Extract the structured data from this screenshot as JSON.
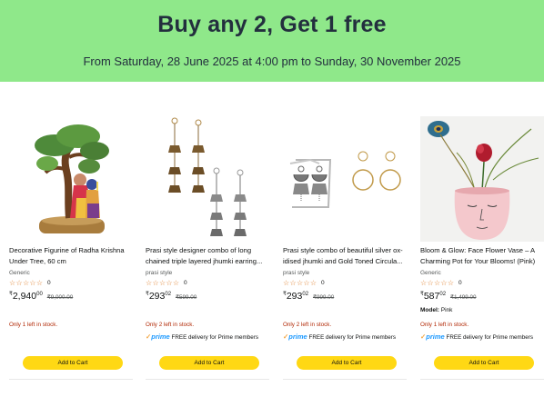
{
  "banner": {
    "title": "Buy any 2, Get 1 free",
    "subtitle": "From Saturday, 28 June 2025 at 4:00 pm to Sunday, 30 November 2025"
  },
  "colors": {
    "banner_bg": "#8fe88a",
    "button": "#ffd814",
    "stock": "#b12704",
    "prime": "#1a98ff",
    "stars": "#de7921"
  },
  "products": [
    {
      "title": "Decorative Figurine of Radha Krishna Under Tree, 60 cm",
      "brand": "Generic",
      "stars": "☆☆☆☆☆",
      "rating_count": "0",
      "price_symbol": "₹",
      "price_whole": "2,940",
      "price_fraction": "00",
      "mrp": "₹9,000.00",
      "stock": "Only 1 left in stock.",
      "button": "Add to Cart",
      "image_icon": "radha-krishna-figurine-image"
    },
    {
      "title": "Prasi style designer combo of long chained triple layered jhumki earring...",
      "brand": "prasi style",
      "stars": "☆☆☆☆☆",
      "rating_count": "0",
      "price_symbol": "₹",
      "price_whole": "293",
      "price_fraction": "02",
      "mrp": "₹599.00",
      "stock": "Only 2 left in stock.",
      "prime_logo": "prime",
      "prime_text": "FREE delivery for Prime members",
      "button": "Add to Cart",
      "image_icon": "jhumki-earrings-image"
    },
    {
      "title": "Prasi style combo of beautiful silver ox-idised jhumki and Gold Toned Circula...",
      "brand": "prasi style",
      "stars": "☆☆☆☆☆",
      "rating_count": "0",
      "price_symbol": "₹",
      "price_whole": "293",
      "price_fraction": "02",
      "mrp": "₹999.00",
      "stock": "Only 2 left in stock.",
      "prime_logo": "prime",
      "prime_text": "FREE delivery for Prime members",
      "button": "Add to Cart",
      "image_icon": "silver-jhumki-and-hoops-image"
    },
    {
      "title": "Bloom & Glow: Face Flower Vase – A Charming Pot for Your Blooms! (Pink)",
      "brand": "Generic",
      "stars": "☆☆☆☆☆",
      "rating_count": "0",
      "price_symbol": "₹",
      "price_whole": "587",
      "price_fraction": "02",
      "mrp": "₹1,499.00",
      "model_label": "Model:",
      "model_value": "Pink",
      "stock": "Only 1 left in stock.",
      "prime_logo": "prime",
      "prime_text": "FREE delivery for Prime members",
      "button": "Add to Cart",
      "image_icon": "face-flower-vase-image"
    }
  ]
}
